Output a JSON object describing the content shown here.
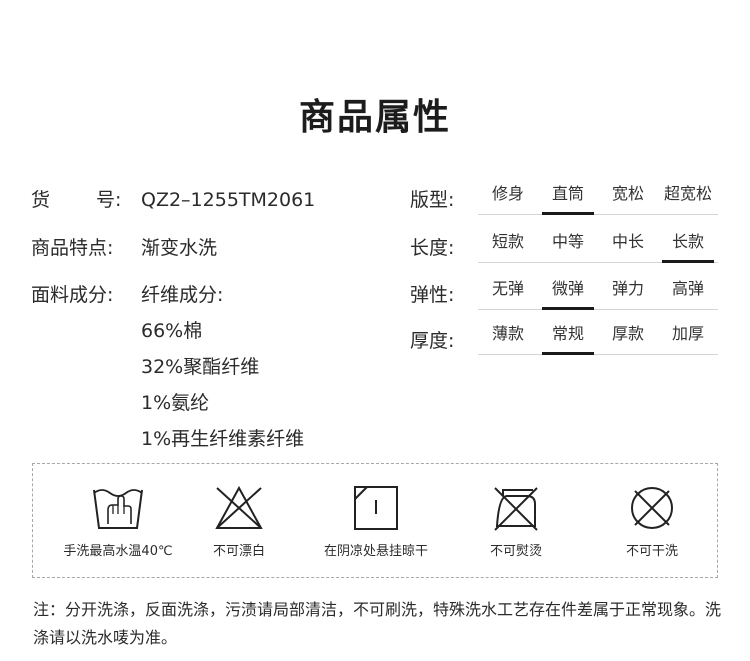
{
  "title": "商品属性",
  "info": {
    "code_label_a": "货",
    "code_label_b": "号:",
    "code_value": "QZ2–1255TM2061",
    "feature_label": "商品特点:",
    "feature_value": "渐变水洗",
    "fabric_label": "面料成分:",
    "fabric_lines": [
      "纤维成分:",
      "66%棉",
      "32%聚酯纤维",
      "1%氨纶",
      "1%再生纤维素纤维"
    ]
  },
  "attributes": [
    {
      "label": "版型:",
      "options": [
        "修身",
        "直筒",
        "宽松",
        "超宽松"
      ],
      "selected": "直筒"
    },
    {
      "label": "长度:",
      "options": [
        "短款",
        "中等",
        "中长",
        "长款"
      ],
      "selected": "长款"
    },
    {
      "label": "弹性:",
      "options": [
        "无弹",
        "微弹",
        "弹力",
        "高弹"
      ],
      "selected": "微弹"
    },
    {
      "label": "厚度:",
      "options": [
        "薄款",
        "常规",
        "厚款",
        "加厚"
      ],
      "selected": "常规"
    }
  ],
  "care": [
    {
      "icon": "hand-wash-icon",
      "label": "手洗最高水温40℃"
    },
    {
      "icon": "no-bleach-icon",
      "label": "不可漂白"
    },
    {
      "icon": "line-dry-shade-icon",
      "label": "在阴凉处悬挂晾干"
    },
    {
      "icon": "no-iron-icon",
      "label": "不可熨烫"
    },
    {
      "icon": "no-dry-clean-icon",
      "label": "不可干洗"
    }
  ],
  "note": "注：分开洗涤，反面洗涤，污渍请局部清洁，不可刷洗，特殊洗水工艺存在件差属于正常现象。洗涤请以洗水唛为准。",
  "colors": {
    "text": "#2b2b2b",
    "underline": "#1a1a1a",
    "divider": "#d4d4d4",
    "border": "#a8a8a8"
  }
}
